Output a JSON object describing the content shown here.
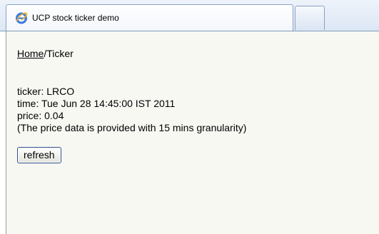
{
  "browser": {
    "tab_title": "UCP stock ticker demo",
    "favicon": "ie-icon"
  },
  "page": {
    "breadcrumb": {
      "home_link": "Home",
      "separator_current": "/Ticker"
    },
    "ticker_line": "ticker: LRCO",
    "time_line": "time: Tue Jun 28 14:45:00 IST 2011",
    "price_line": "price: 0.04",
    "note_line": "(The price data is provided with 15 mins granularity)",
    "refresh_label": "refresh"
  }
}
